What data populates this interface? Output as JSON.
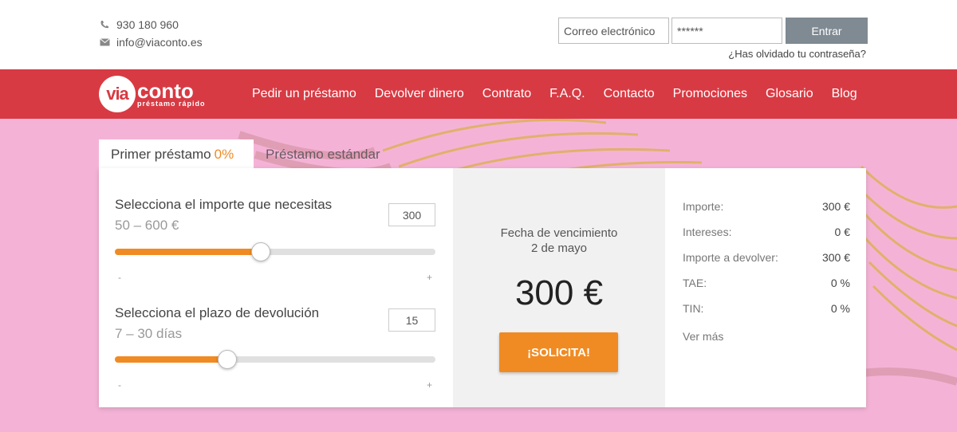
{
  "contact": {
    "phone": "930 180 960",
    "email": "info@viaconto.es"
  },
  "login": {
    "email_value": "Correo electrónico",
    "password_value": "******",
    "submit_label": "Entrar",
    "forgot_label": "¿Has olvidado tu contraseña?"
  },
  "brand": {
    "logo_circle": "via",
    "logo_word": "conto",
    "tagline": "préstamo rápido",
    "primary_color": "#d83a43",
    "accent_color": "#f08b24"
  },
  "nav": {
    "items": [
      {
        "label": "Pedir un préstamo"
      },
      {
        "label": "Devolver dinero"
      },
      {
        "label": "Contrato"
      },
      {
        "label": "F.A.Q."
      },
      {
        "label": "Contacto"
      },
      {
        "label": "Promociones"
      },
      {
        "label": "Glosario"
      },
      {
        "label": "Blog"
      }
    ]
  },
  "tabs": {
    "first_label": "Primer préstamo",
    "first_pct": "0%",
    "second_label": "Préstamo estándar"
  },
  "amount_slider": {
    "title": "Selecciona el importe que necesitas",
    "range": "50 – 600 €",
    "value": "300",
    "fraction": 0.455,
    "minus": "-",
    "plus": "+"
  },
  "term_slider": {
    "title": "Selecciona el plazo de devolución",
    "range": "7 – 30 días",
    "value": "15",
    "fraction": 0.35,
    "minus": "-",
    "plus": "+"
  },
  "due": {
    "label": "Fecha de vencimiento",
    "date": "2 de mayo",
    "amount": "300 €",
    "cta_label": "¡SOLICITA!"
  },
  "summary": {
    "rows": [
      {
        "label": "Importe:",
        "value": "300 €"
      },
      {
        "label": "Intereses:",
        "value": "0 €"
      },
      {
        "label": "Importe a devolver:",
        "value": "300 €"
      },
      {
        "label": "TAE:",
        "value": "0 %"
      },
      {
        "label": "TIN:",
        "value": "0 %"
      }
    ],
    "more_label": "Ver más"
  }
}
